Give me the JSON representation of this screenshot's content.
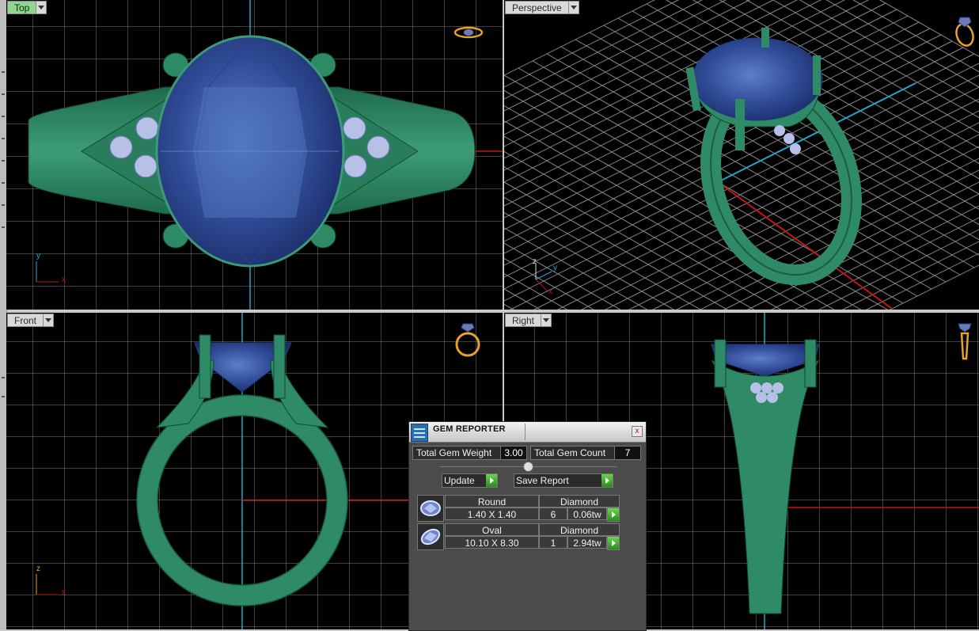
{
  "viewports": {
    "top": {
      "label": "Top"
    },
    "perspective": {
      "label": "Perspective"
    },
    "front": {
      "label": "Front"
    },
    "right": {
      "label": "Right"
    }
  },
  "axes": {
    "top": {
      "a": "y",
      "b": "x"
    },
    "perspective": {
      "a": "z",
      "b": "y",
      "c": "x"
    },
    "front": {
      "a": "z",
      "b": "x"
    }
  },
  "gem_reporter": {
    "title": "GEM REPORTER",
    "close_label": "x",
    "total_weight_label": "Total Gem Weight",
    "total_weight_value": "3.00",
    "total_count_label": "Total Gem Count",
    "total_count_value": "7",
    "update_label": "Update",
    "save_report_label": "Save Report",
    "gems": [
      {
        "shape": "Round",
        "material": "Diamond",
        "size": "1.40 X 1.40",
        "count": "6",
        "weight": "0.06tw"
      },
      {
        "shape": "Oval",
        "material": "Diamond",
        "size": "10.10 X 8.30",
        "count": "1",
        "weight": "2.94tw"
      }
    ]
  },
  "colors": {
    "metal": "#2f8a66",
    "gem": "#3d5aa8",
    "grid": "#8a8a8a",
    "axis_x": "#c41616",
    "axis_y": "#1aa8c8",
    "accent_active": "#8fd68f"
  }
}
